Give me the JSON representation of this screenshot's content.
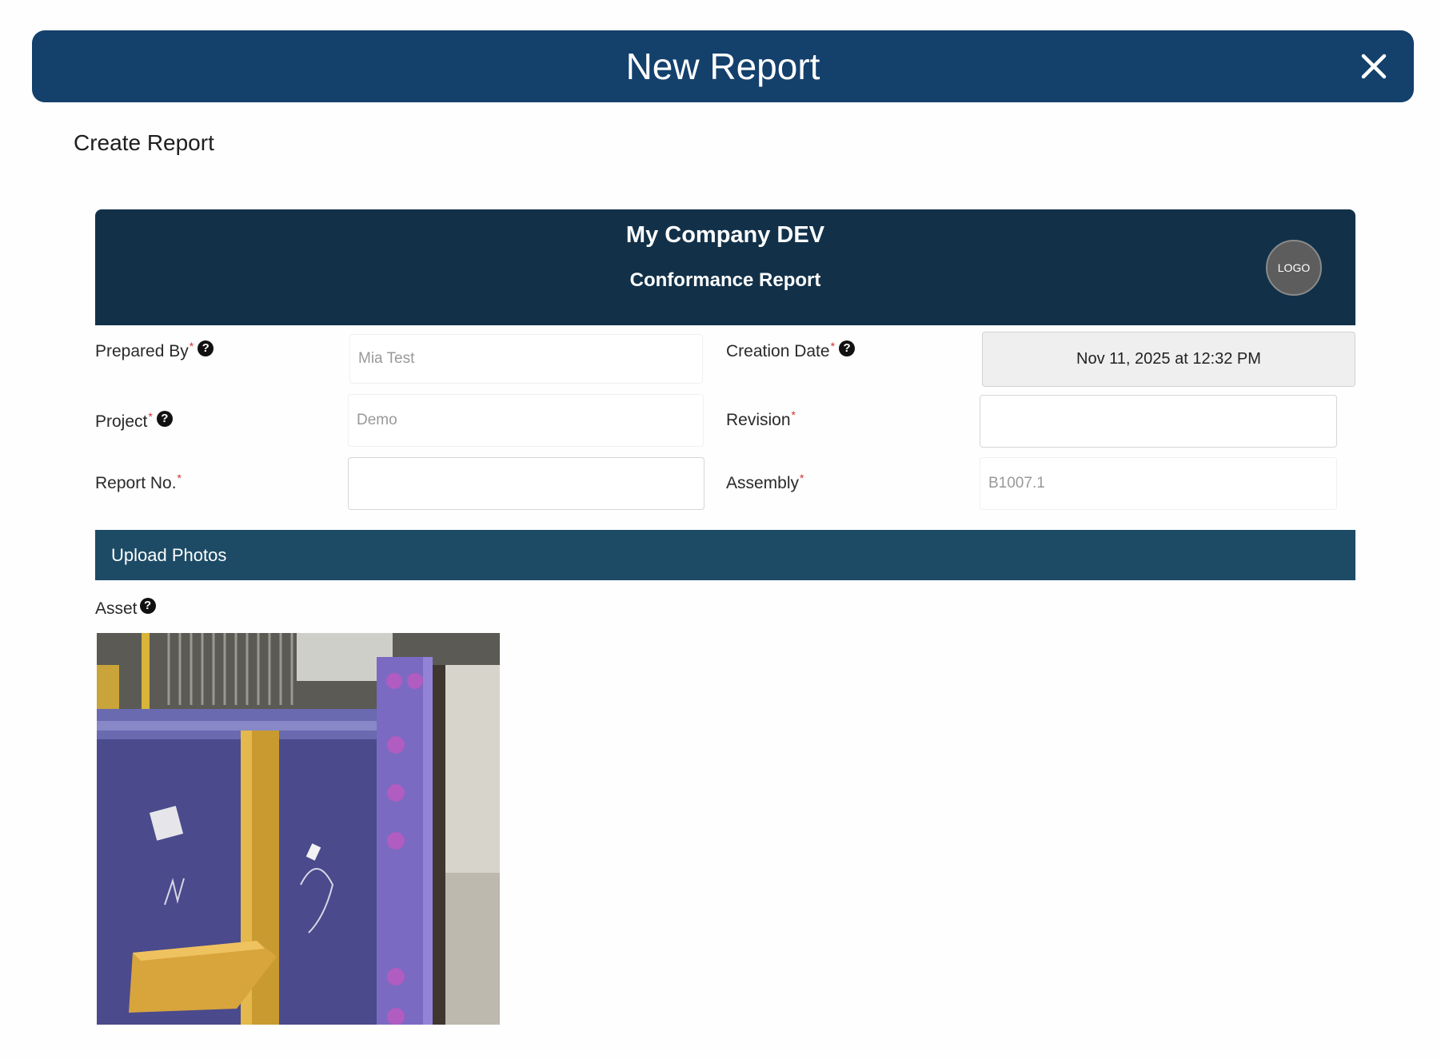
{
  "window": {
    "title": "New Report",
    "close_icon": "close-icon"
  },
  "page": {
    "heading": "Create Report"
  },
  "company": {
    "name": "My Company DEV",
    "report_type": "Conformance Report",
    "logo_text": "LOGO"
  },
  "form": {
    "prepared_by": {
      "label": "Prepared By",
      "value": "Mia Test"
    },
    "creation_date": {
      "label": "Creation Date",
      "value": "Nov 11, 2025 at 12:32 PM"
    },
    "project": {
      "label": "Project",
      "value": "Demo"
    },
    "revision": {
      "label": "Revision",
      "value": ""
    },
    "report_no": {
      "label": "Report No.",
      "value": ""
    },
    "assembly": {
      "label": "Assembly",
      "value": "B1007.1"
    },
    "required_mark": "*",
    "help_glyph": "?"
  },
  "upload": {
    "section_title": "Upload Photos",
    "asset_label": "Asset"
  },
  "colors": {
    "title_bar": "#14406c",
    "company_banner": "#123149",
    "upload_bar": "#1d4b66",
    "required": "#d23030"
  }
}
